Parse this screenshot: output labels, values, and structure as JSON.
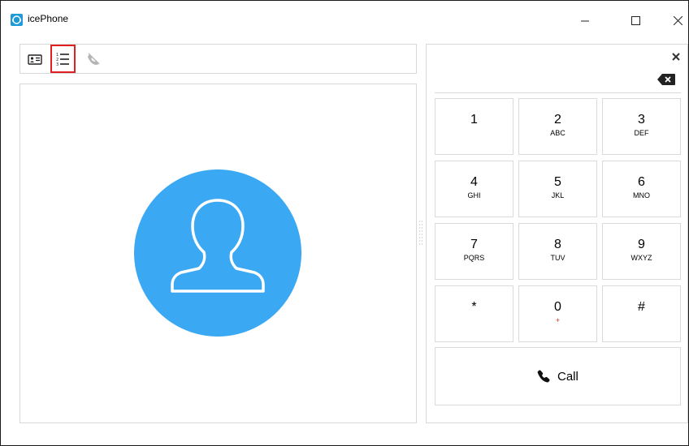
{
  "window": {
    "title": "icePhone"
  },
  "toolbar": {
    "buttons": [
      {
        "icon": "contact-card-icon"
      },
      {
        "icon": "numbered-list-icon",
        "highlighted": true
      },
      {
        "icon": "muted-phone-icon",
        "disabled": true
      }
    ]
  },
  "avatar": {
    "icon": "person-silhouette-icon",
    "color": "#3aa8f3"
  },
  "dialpad": {
    "keys": [
      {
        "digit": "1",
        "letters": ""
      },
      {
        "digit": "2",
        "letters": "ABC"
      },
      {
        "digit": "3",
        "letters": "DEF"
      },
      {
        "digit": "4",
        "letters": "GHI"
      },
      {
        "digit": "5",
        "letters": "JKL"
      },
      {
        "digit": "6",
        "letters": "MNO"
      },
      {
        "digit": "7",
        "letters": "PQRS"
      },
      {
        "digit": "8",
        "letters": "TUV"
      },
      {
        "digit": "9",
        "letters": "WXYZ"
      },
      {
        "digit": "*",
        "letters": ""
      },
      {
        "digit": "0",
        "letters": "+"
      },
      {
        "digit": "#",
        "letters": ""
      }
    ],
    "call_label": "Call"
  }
}
